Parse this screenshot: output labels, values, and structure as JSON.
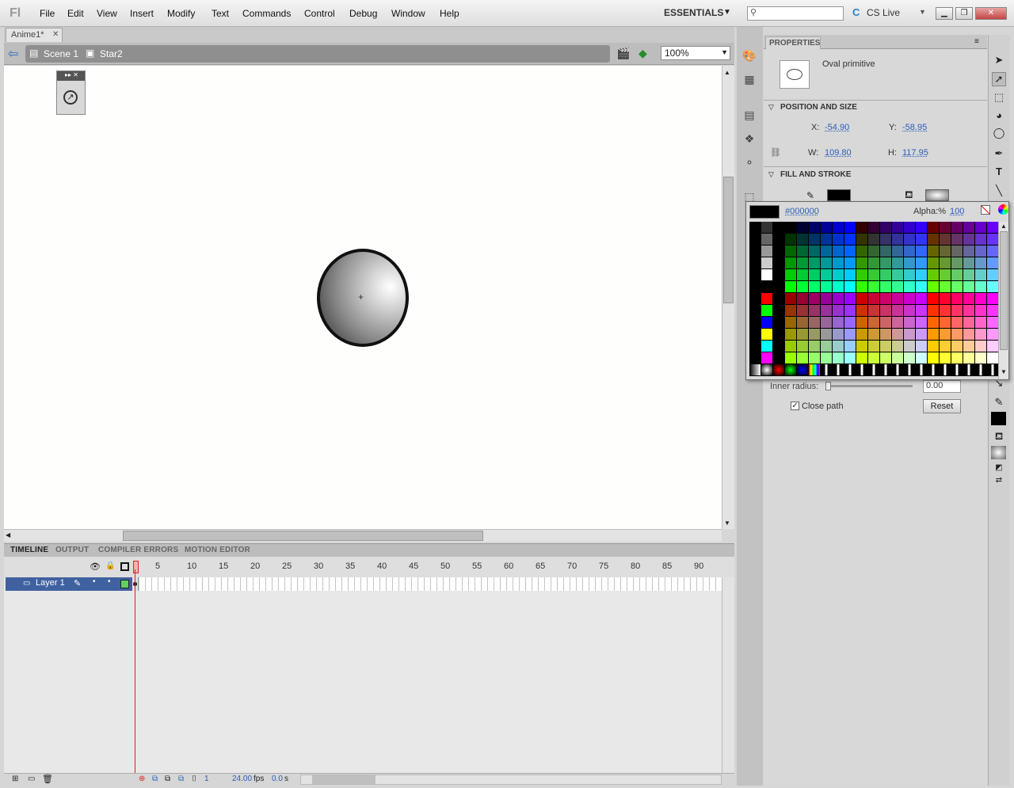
{
  "app": {
    "logo": "Fl"
  },
  "menu": [
    "File",
    "Edit",
    "View",
    "Insert",
    "Modify",
    "Text",
    "Commands",
    "Control",
    "Debug",
    "Window",
    "Help"
  ],
  "workspace": {
    "label": "ESSENTIALS",
    "cs_live": "CS Live"
  },
  "document": {
    "tab": "Anime1*",
    "scene": "Scene 1",
    "symbol": "Star2",
    "zoom": "100%"
  },
  "timeline": {
    "tabs": [
      "TIMELINE",
      "OUTPUT",
      "COMPILER ERRORS",
      "MOTION EDITOR"
    ],
    "frame_numbers": [
      "5",
      "10",
      "15",
      "20",
      "25",
      "30",
      "35",
      "40",
      "45",
      "50",
      "55",
      "60",
      "65",
      "70",
      "75",
      "80",
      "85",
      "90"
    ],
    "layer": "Layer 1",
    "current_frame": "1",
    "fps": "24.00",
    "fps_unit": "fps",
    "time": "0.0",
    "time_unit": "s"
  },
  "properties": {
    "tab": "PROPERTIES",
    "object_type": "Oval primitive",
    "pos_header": "POSITION AND SIZE",
    "x_label": "X:",
    "x": "-54.90",
    "y_label": "Y:",
    "y": "-58.95",
    "w_label": "W:",
    "w": "109.80",
    "h_label": "H:",
    "h": "117.95",
    "fill_header": "FILL AND STROKE",
    "inner_radius_label": "Inner radius:",
    "inner_radius": "0.00",
    "close_path": "Close path",
    "reset": "Reset"
  },
  "swatches": {
    "hex": "#000000",
    "alpha_label": "Alpha:%",
    "alpha": "100"
  },
  "colors": {
    "accent": "#3f61a0",
    "playhead": "#e52020",
    "layer_color": "#5dd35d"
  }
}
